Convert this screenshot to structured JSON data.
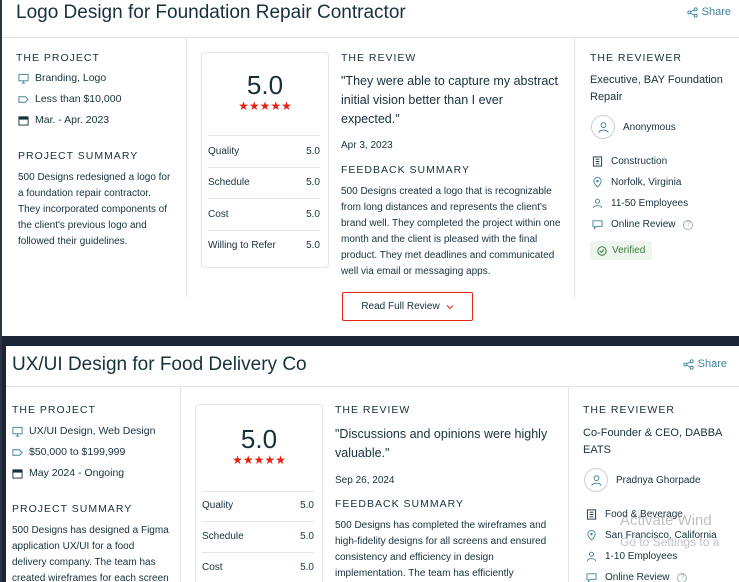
{
  "share_label": "Share",
  "cards": [
    {
      "title": "Logo Design for Foundation Repair Contractor",
      "project_heading": "THE PROJECT",
      "services": "Branding, Logo",
      "budget": "Less than $10,000",
      "dates": "Mar. - Apr. 2023",
      "summary_heading": "PROJECT SUMMARY",
      "summary": [
        "500 Designs redesigned a logo for",
        "a foundation repair contractor.",
        "They incorporated components of",
        "the client's previous logo and",
        "followed their guidelines."
      ],
      "score": "5.0",
      "stars": "★★★★★",
      "ratings": [
        {
          "label": "Quality",
          "value": "5.0"
        },
        {
          "label": "Schedule",
          "value": "5.0"
        },
        {
          "label": "Cost",
          "value": "5.0"
        },
        {
          "label": "Willing to Refer",
          "value": "5.0"
        }
      ],
      "review_heading": "THE REVIEW",
      "quote": [
        "\"They were able to capture my abstract",
        "initial vision better than I ever",
        "expected.\""
      ],
      "review_date": "Apr 3, 2023",
      "feedback_heading": "FEEDBACK SUMMARY",
      "feedback": [
        "500 Designs created a logo that is recognizable",
        "from long distances and represents the client's",
        "brand well. They completed the project within one",
        "month and the client is pleased with the final",
        "product. They met deadlines and communicated",
        "well via email or messaging apps."
      ],
      "read_more": "Read Full Review",
      "reviewer_heading": "THE REVIEWER",
      "reviewer_title": [
        "Executive, BAY Foundation",
        "Repair"
      ],
      "reviewer_name": "Anonymous",
      "industry": "Construction",
      "location": "Norfolk, Virginia",
      "employees": "11-50 Employees",
      "review_type": "Online Review",
      "help_glyph": "?",
      "verified": "Verified"
    },
    {
      "title": "UX/UI Design for Food Delivery Co",
      "project_heading": "THE PROJECT",
      "services": "UX/UI Design, Web Design",
      "budget": "$50,000 to $199,999",
      "dates": "May 2024 - Ongoing",
      "summary_heading": "PROJECT SUMMARY",
      "summary": [
        "500 Designs has designed a Figma",
        "application UX/UI for a food",
        "delivery company. The team has",
        "created wireframes for each screen"
      ],
      "score": "5.0",
      "stars": "★★★★★",
      "ratings": [
        {
          "label": "Quality",
          "value": "5.0"
        },
        {
          "label": "Schedule",
          "value": "5.0"
        },
        {
          "label": "Cost",
          "value": "5.0"
        }
      ],
      "review_heading": "THE REVIEW",
      "quote": [
        "\"Discussions and opinions were highly",
        "valuable.\""
      ],
      "review_date": "Sep 26, 2024",
      "feedback_heading": "FEEDBACK SUMMARY",
      "feedback": [
        "500 Designs has completed the wireframes and",
        "high-fidelity designs for all screens and ensured",
        "consistency and efficiency in design",
        "implementation. The team has efficiently"
      ],
      "reviewer_heading": "THE REVIEWER",
      "reviewer_title": [
        "Co-Founder & CEO, DABBA",
        "EATS"
      ],
      "reviewer_name": "Pradnya Ghorpade",
      "industry": "Food & Beverage",
      "location": "San Francisco, California",
      "employees": "1-10 Employees",
      "review_type": "Online Review",
      "help_glyph": "?"
    }
  ],
  "watermark": {
    "line1": "Activate Wind",
    "line2": "Go to Settings to a"
  }
}
